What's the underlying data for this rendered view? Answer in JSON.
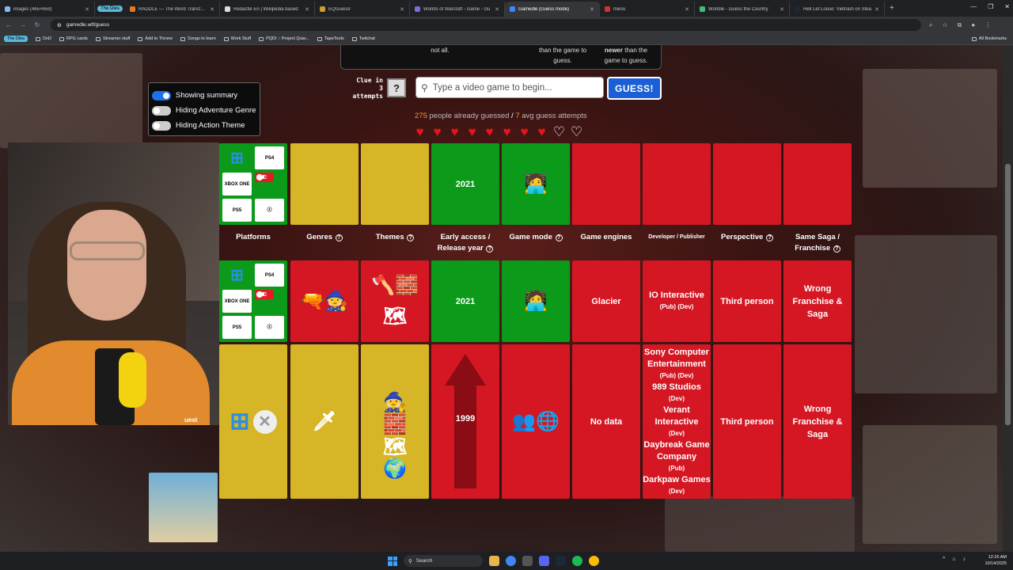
{
  "browser": {
    "tabs": [
      {
        "title": "images (465×659)",
        "active": false
      },
      {
        "group": "The Dles"
      },
      {
        "title": "RADDLE — The Word Transform",
        "active": false
      },
      {
        "title": "Redactle En | Wikipedia based",
        "active": false
      },
      {
        "title": "EQGuessr",
        "active": false
      },
      {
        "title": "Worlds of Warcraft - Game - Gu",
        "active": false
      },
      {
        "title": "Gamedle (Guess mode)",
        "active": true
      },
      {
        "title": "menu",
        "active": false
      },
      {
        "title": "Worldle - Guess the Country",
        "active": false
      },
      {
        "title": "Hell Let Loose: Vietnam on Stea",
        "active": false
      }
    ],
    "url": "gamedle.wtf/guess",
    "bookmarks": [
      "The Dles",
      "DnD",
      "RPG cards",
      "Streamer stuff",
      "Add to Throne",
      "Songs to learn",
      "Work Stuff",
      "PQDI :: Project Quar...",
      "TapeTools",
      "Twitchat"
    ],
    "all_bookmarks": "All Bookmarks"
  },
  "game": {
    "topbox": {
      "col1": "not all.",
      "col2": "than the game to guess.",
      "col3_bold": "newer",
      "col3": "than the game to guess."
    },
    "toggles": [
      {
        "label": "Showing summary",
        "on": true
      },
      {
        "label": "Hiding Adventure Genre",
        "on": false
      },
      {
        "label": "Hiding Action Theme",
        "on": false
      }
    ],
    "clue": {
      "line1": "Clue in",
      "line2": "3",
      "line3": "attempts",
      "icon": "?"
    },
    "search_placeholder": "Type a video game to begin...",
    "guess_button": "GUESS!",
    "stats": {
      "people": "275",
      "people_text": "people already guessed",
      "sep": "/",
      "avg": "7",
      "avg_text": "avg guess attempts"
    },
    "hearts": {
      "filled": 8,
      "total": 10
    },
    "headers": {
      "platforms": "Platforms",
      "genres": "Genres",
      "themes": "Themes",
      "release": "Early access / Release year",
      "game_mode": "Game mode",
      "engines": "Game engines",
      "dev": "Developer / Publisher",
      "perspective": "Perspective",
      "saga": "Same Saga / Franchise"
    },
    "summary_row": {
      "release": "2021"
    },
    "row1": {
      "release": "2021",
      "engine": "Glacier",
      "dev_name": "IO Interactive",
      "dev_role": "(Pub) (Dev)",
      "perspective": "Third person",
      "saga": "Wrong Franchise & Saga"
    },
    "row2": {
      "release": "1999",
      "engine": "No data",
      "devs": [
        {
          "name": "Sony Computer Entertainment",
          "role": "(Pub) (Dev)"
        },
        {
          "name": "989 Studios",
          "role": "(Dev)"
        },
        {
          "name": "Verant Interactive",
          "role": "(Dev)"
        },
        {
          "name": "Daybreak Game Company",
          "role": "(Pub)"
        },
        {
          "name": "Darkpaw Games",
          "role": "(Dev)"
        }
      ],
      "perspective": "Third person",
      "saga": "Wrong Franchise & Saga"
    },
    "platform_labels": {
      "xbox_one": "XBOX ONE",
      "ps4": "PS4",
      "switch": "NINTENDO SWITCH",
      "ps5": "PS5",
      "xbox_series": "XBOX SERIES X"
    },
    "stream_label": "uest"
  },
  "taskbar": {
    "search": "Search",
    "time": "12:26 AM",
    "date": "10/14/2025"
  },
  "colors": {
    "green": "#0c9a1b",
    "red": "#d41723",
    "yellow": "#d6b526",
    "accent": "#1a5fd6"
  }
}
